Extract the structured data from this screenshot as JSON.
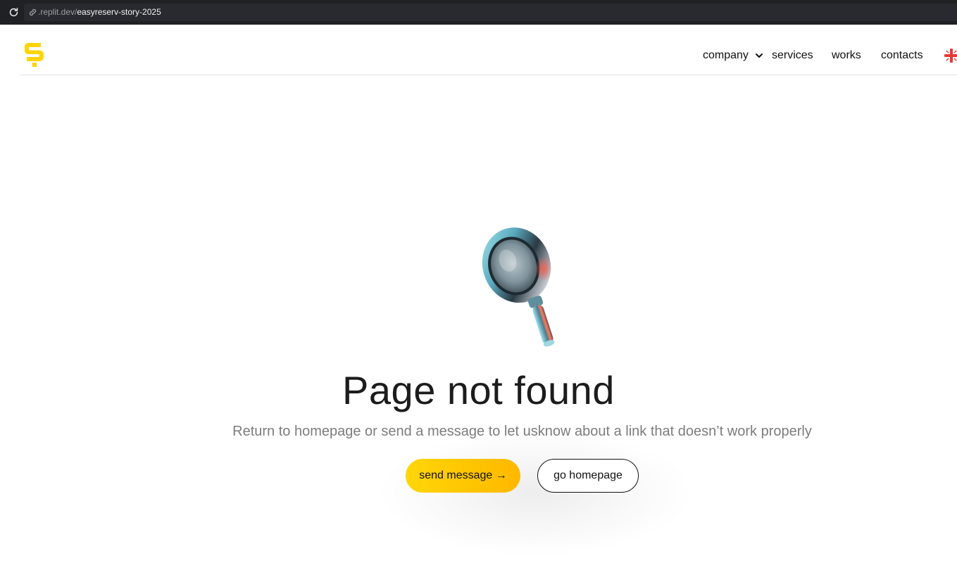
{
  "browser": {
    "url_prefix": ".replit.dev/",
    "url_path": "easyreserv-story-2025"
  },
  "header": {
    "logo_icon": "brand-s-logo",
    "nav": {
      "company": "company",
      "services": "services",
      "works": "works",
      "contacts": "contacts"
    },
    "language_icon": "uk-flag-icon"
  },
  "main": {
    "illustration_icon": "magnifying-glass-icon",
    "title": "Page not found",
    "subtitle": "Return to homepage or send a message to let usknow about a link that doesn’t work properly",
    "send_button": "send message →",
    "home_button": "go homepage"
  },
  "colors": {
    "accent": "#ffd000",
    "browser_bar": "#202124",
    "text": "#1c1c1c",
    "muted": "#7d7d7d"
  }
}
